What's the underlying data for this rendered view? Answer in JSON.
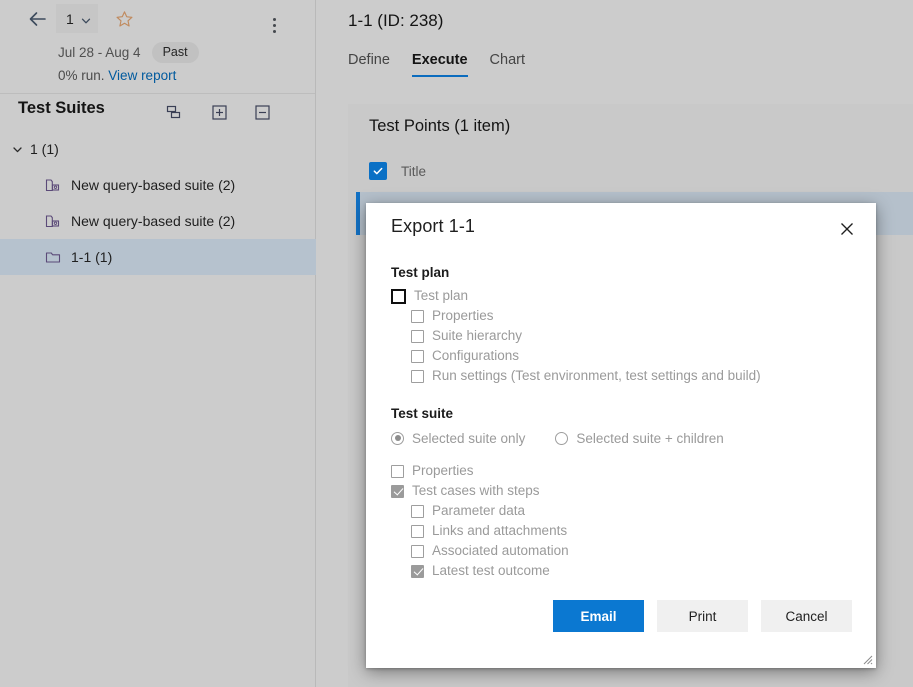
{
  "left_pane": {
    "header": {
      "back_icon": "back-arrow-icon",
      "plan_selector_value": "1",
      "plan_selector_chevron": "chevron-down-icon",
      "favorite_icon": "star-outline-icon",
      "more_icon": "more-vertical-icon",
      "date_range": "Jul 28 - Aug 4",
      "status_badge": "Past",
      "run_percent_text": "0% run.",
      "report_link": "View report"
    },
    "suites": {
      "title": "Test Suites",
      "toolbar": [
        {
          "name": "show-test-suites-icon",
          "tooltip": "Show test suites"
        },
        {
          "name": "expand-all-icon",
          "tooltip": "Expand all"
        },
        {
          "name": "collapse-all-icon",
          "tooltip": "Collapse all"
        }
      ],
      "tree": [
        {
          "label": "1 (1)",
          "icon": "none",
          "indent": 0,
          "caret": "chevron-down-icon",
          "selected": false
        },
        {
          "label": "New query-based suite (2)",
          "icon": "query-suite-icon",
          "indent": 1,
          "caret": "",
          "selected": false
        },
        {
          "label": "New query-based suite (2)",
          "icon": "query-suite-icon",
          "indent": 1,
          "caret": "",
          "selected": false
        },
        {
          "label": "1-1 (1)",
          "icon": "folder-suite-icon",
          "indent": 1,
          "caret": "",
          "selected": true
        }
      ]
    }
  },
  "right_pane": {
    "title": "1-1 (ID: 238)",
    "tabs": [
      {
        "label": "Define",
        "active": false
      },
      {
        "label": "Execute",
        "active": true
      },
      {
        "label": "Chart",
        "active": false
      }
    ],
    "test_points": {
      "heading": "Test Points (1 item)",
      "select_all_icon": "checkbox-checked-icon",
      "column_title": "Title"
    }
  },
  "dialog": {
    "title": "Export 1-1",
    "close_icon": "close-icon",
    "resize_grip_icon": "resize-grip-icon",
    "sections": [
      {
        "heading": "Test plan",
        "options": [
          {
            "label": "Test plan",
            "type": "checkbox",
            "checked": false,
            "indent": 0,
            "focused": true
          },
          {
            "label": "Properties",
            "type": "checkbox",
            "checked": false,
            "indent": 1,
            "focused": false
          },
          {
            "label": "Suite hierarchy",
            "type": "checkbox",
            "checked": false,
            "indent": 1,
            "focused": false
          },
          {
            "label": "Configurations",
            "type": "checkbox",
            "checked": false,
            "indent": 1,
            "focused": false
          },
          {
            "label": "Run settings (Test environment, test settings and build)",
            "type": "checkbox",
            "checked": false,
            "indent": 1,
            "focused": false
          }
        ]
      },
      {
        "heading": "Test suite",
        "radios": [
          {
            "label": "Selected suite only",
            "selected": true
          },
          {
            "label": "Selected suite + children",
            "selected": false
          }
        ],
        "options": [
          {
            "label": "Properties",
            "type": "checkbox",
            "checked": false,
            "indent": 0,
            "focused": false
          },
          {
            "label": "Test cases with steps",
            "type": "checkbox",
            "checked": true,
            "indent": 0,
            "focused": false
          },
          {
            "label": "Parameter data",
            "type": "checkbox",
            "checked": false,
            "indent": 1,
            "focused": false
          },
          {
            "label": "Links and attachments",
            "type": "checkbox",
            "checked": false,
            "indent": 1,
            "focused": false
          },
          {
            "label": "Associated automation",
            "type": "checkbox",
            "checked": false,
            "indent": 1,
            "focused": false
          },
          {
            "label": "Latest test outcome",
            "type": "checkbox",
            "checked": true,
            "indent": 1,
            "focused": false
          }
        ]
      }
    ],
    "buttons": [
      {
        "label": "Email",
        "style": "primary"
      },
      {
        "label": "Print",
        "style": "secondary"
      },
      {
        "label": "Cancel",
        "style": "secondary"
      }
    ]
  },
  "colors": {
    "accent_blue": "#0b78d1",
    "tab_underline": "#0b6cbe",
    "link_blue": "#005a9e",
    "page_bg": "#cccccc",
    "selected_row": "#b6c2ce",
    "dialog_bg": "#ffffff"
  }
}
